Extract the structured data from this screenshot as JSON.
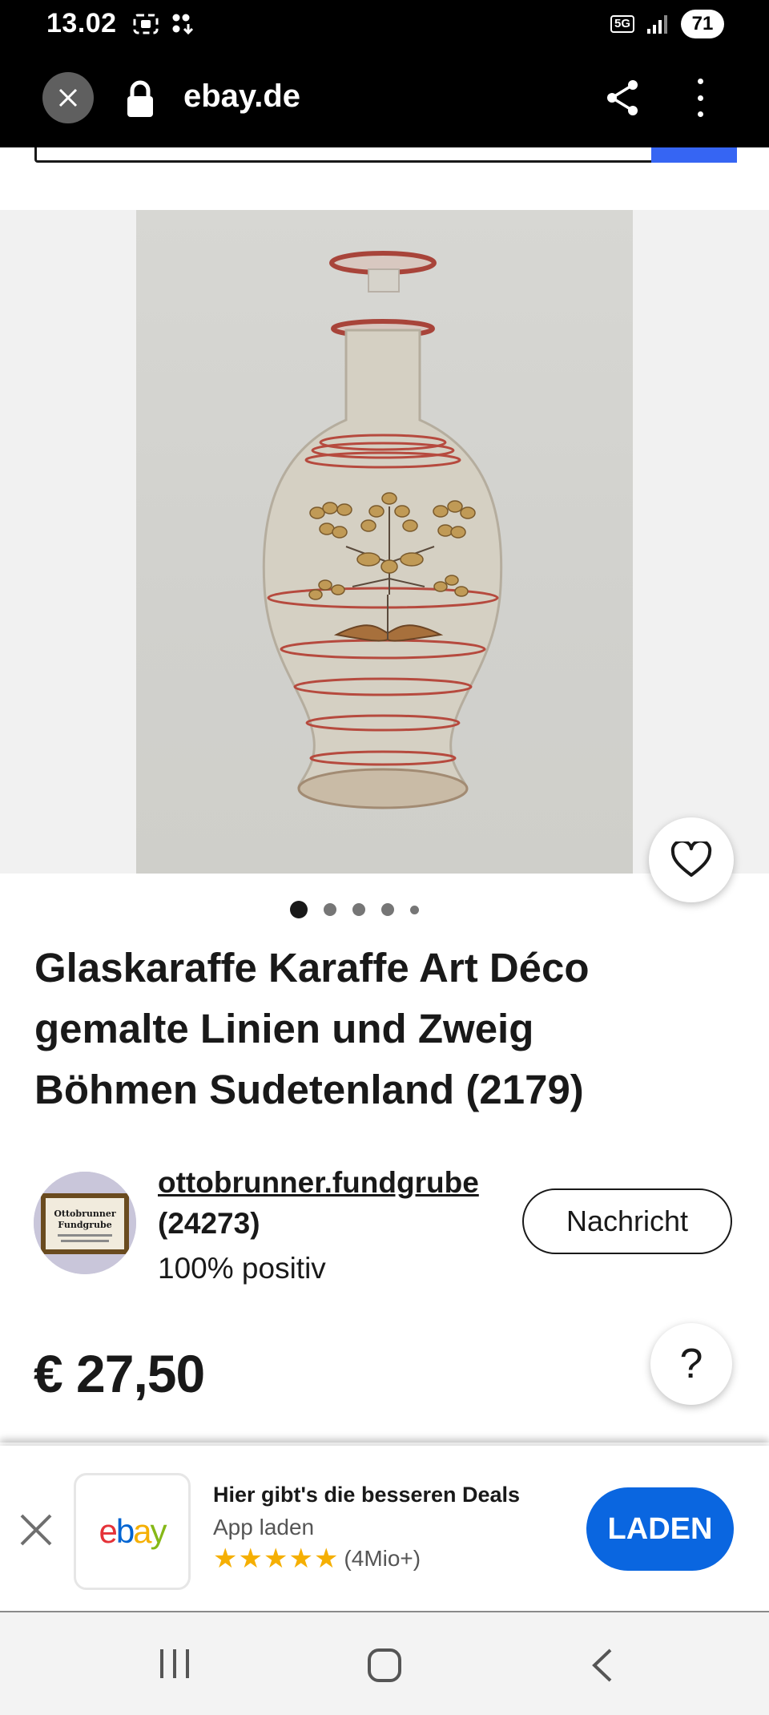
{
  "status_bar": {
    "time": "13.02",
    "network": "5G",
    "battery": "71"
  },
  "browser": {
    "domain": "ebay.de"
  },
  "gallery": {
    "image_count": 5,
    "active_index": 0
  },
  "listing": {
    "title_lines": [
      "Glaskaraffe Karaffe Art Déco",
      "gemalte Linien und Zweig",
      "Böhmen Sudetenland (2179)"
    ],
    "price": "€ 27,50"
  },
  "seller": {
    "name": "ottobrunner.fundgrube",
    "feedback_count": "(24273)",
    "positive": "100% positiv",
    "avatar_text_line1": "Ottobrunner",
    "avatar_text_line2": "Fundgrube",
    "message_button": "Nachricht"
  },
  "help_button": {
    "label": "?"
  },
  "app_banner": {
    "headline": "Hier gibt's die besseren Deals",
    "subline": "App laden",
    "rating_stars": 5,
    "review_count": "(4Mio+)",
    "install_label": "LADEN",
    "logo_letters": [
      "e",
      "b",
      "a",
      "y"
    ]
  },
  "colors": {
    "ebay_e": "#e53238",
    "ebay_b": "#0064d2",
    "ebay_a": "#f5af02",
    "ebay_y": "#86b817",
    "accent_blue": "#0a66e0"
  }
}
